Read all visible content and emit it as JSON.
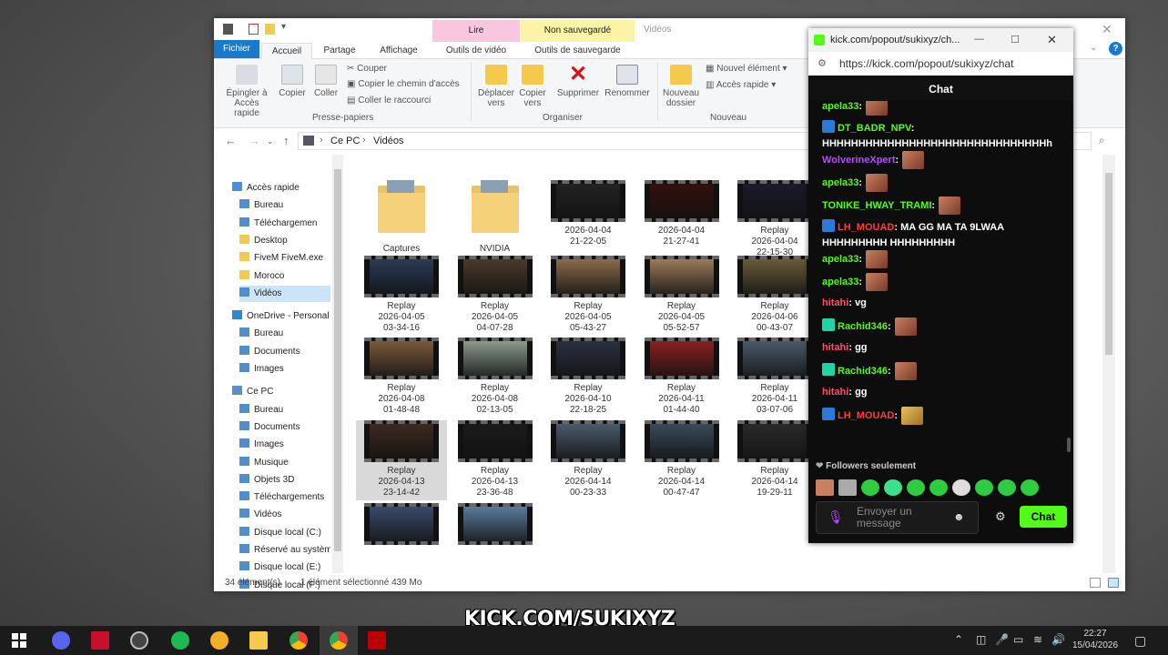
{
  "explorer": {
    "context_tabs": {
      "lire": "Lire",
      "non_sauvegarde": "Non sauvegardé",
      "window_title": "Vidéos"
    },
    "ribbon_tabs": [
      "Fichier",
      "Accueil",
      "Partage",
      "Affichage",
      "Outils de vidéo",
      "Outils de sauvegarde"
    ],
    "ribbon": {
      "pin": "Épingler à Accès rapide",
      "copy": "Copier",
      "paste": "Coller",
      "cut": "Couper",
      "copy_path": "Copier le chemin d'accès",
      "paste_shortcut": "Coller le raccourci",
      "clipboard_group": "Presse-papiers",
      "move_to": "Déplacer vers",
      "copy_to": "Copier vers",
      "delete": "Supprimer",
      "rename": "Renommer",
      "organize_group": "Organiser",
      "new_folder": "Nouveau dossier",
      "new_item": "Nouvel élément",
      "easy_access": "Accès rapide",
      "new_group": "Nouveau"
    },
    "address": {
      "root": "Ce PC",
      "current": "Vidéos"
    },
    "nav": [
      "Accès rapide",
      "Bureau",
      "Téléchargemen",
      "Desktop",
      "FiveM FiveM.exe",
      "Moroco",
      "Vidéos",
      "OneDrive - Personal",
      "Bureau",
      "Documents",
      "Images",
      "Ce PC",
      "Bureau",
      "Documents",
      "Images",
      "Musique",
      "Objets 3D",
      "Téléchargements",
      "Vidéos",
      "Disque local (C:)",
      "Réservé au systèm",
      "Disque local (E:)",
      "Disque local (F:)"
    ],
    "files": [
      {
        "l1": "Captures",
        "l2": "",
        "l3": ""
      },
      {
        "l1": "NVIDIA",
        "l2": "",
        "l3": ""
      },
      {
        "l1": "2026-04-04",
        "l2": "21-22-05",
        "l3": ""
      },
      {
        "l1": "2026-04-04",
        "l2": "21-27-41",
        "l3": ""
      },
      {
        "l1": "Replay",
        "l2": "2026-04-04",
        "l3": "22-15-30"
      },
      {
        "l1": "Replay",
        "l2": "2026-04-05",
        "l3": "03-34-16"
      },
      {
        "l1": "Replay",
        "l2": "2026-04-05",
        "l3": "04-07-28"
      },
      {
        "l1": "Replay",
        "l2": "2026-04-05",
        "l3": "05-43-27"
      },
      {
        "l1": "Replay",
        "l2": "2026-04-05",
        "l3": "05-52-57"
      },
      {
        "l1": "Replay",
        "l2": "2026-04-06",
        "l3": "00-43-07"
      },
      {
        "l1": "Replay",
        "l2": "2026-04-08",
        "l3": "01-48-48"
      },
      {
        "l1": "Replay",
        "l2": "2026-04-08",
        "l3": "02-13-05"
      },
      {
        "l1": "Replay",
        "l2": "2026-04-10",
        "l3": "22-18-25"
      },
      {
        "l1": "Replay",
        "l2": "2026-04-11",
        "l3": "01-44-40"
      },
      {
        "l1": "Replay",
        "l2": "2026-04-11",
        "l3": "03-07-06"
      },
      {
        "l1": "Replay",
        "l2": "2026-04-13",
        "l3": "23-14-42"
      },
      {
        "l1": "Replay",
        "l2": "2026-04-13",
        "l3": "23-36-48"
      },
      {
        "l1": "Replay",
        "l2": "2026-04-14",
        "l3": "00-23-33"
      },
      {
        "l1": "Replay",
        "l2": "2026-04-14",
        "l3": "00-47-47"
      },
      {
        "l1": "Replay",
        "l2": "2026-04-14",
        "l3": "19-29-11"
      },
      {
        "l1": "",
        "l2": "",
        "l3": ""
      },
      {
        "l1": "",
        "l2": "",
        "l3": ""
      }
    ],
    "status": {
      "count": "34 élément(s)",
      "selected": "1 élément sélectionné 439 Mo"
    }
  },
  "chat": {
    "window_title": "kick.com/popout/sukixyz/ch...",
    "url": "https://kick.com/popout/sukixyz/chat",
    "header": "Chat",
    "messages": [
      {
        "user": "apela33",
        "text": ":",
        "color": "#53fc18"
      },
      {
        "user": "DT_BADR_NPV",
        "text": ": HHHHHHHHHHHHHHHHHHHHHHHHHHHHHHHh",
        "color": "#53fc18"
      },
      {
        "user": "WolverineXpert",
        "text": ":",
        "color": "#b84dff"
      },
      {
        "user": "apela33",
        "text": ":",
        "color": "#53fc18"
      },
      {
        "user": "TONIKE_HWAY_TRAMI",
        "text": ":",
        "color": "#53fc18"
      },
      {
        "user": "LH_MOUAD",
        "text": ": MA GG MA TA 9LWAA HHHHHHHHH HHHHHHHHH",
        "color": "#ff3b3b"
      },
      {
        "user": "apela33",
        "text": ":",
        "color": "#53fc18"
      },
      {
        "user": "apela33",
        "text": ":",
        "color": "#53fc18"
      },
      {
        "user": "hitahi",
        "text": ": vg",
        "color": "#ff4d6a"
      },
      {
        "user": "Rachid346",
        "text": ":",
        "color": "#53fc18"
      },
      {
        "user": "hitahi",
        "text": ": gg",
        "color": "#ff4d6a"
      },
      {
        "user": "Rachid346",
        "text": ":",
        "color": "#53fc18"
      },
      {
        "user": "hitahi",
        "text": ": gg",
        "color": "#ff4d6a"
      },
      {
        "user": "LH_MOUAD",
        "text": ":",
        "color": "#ff3b3b"
      }
    ],
    "followers_only": "Followers seulement",
    "input_placeholder": "Envoyer un message",
    "send_button": "Chat",
    "accent": "#53fc18"
  },
  "overlay": {
    "brand": "KICK.COM/SUKIXYZ"
  },
  "taskbar": {
    "time": "22:27",
    "date": "15/04/2026"
  }
}
